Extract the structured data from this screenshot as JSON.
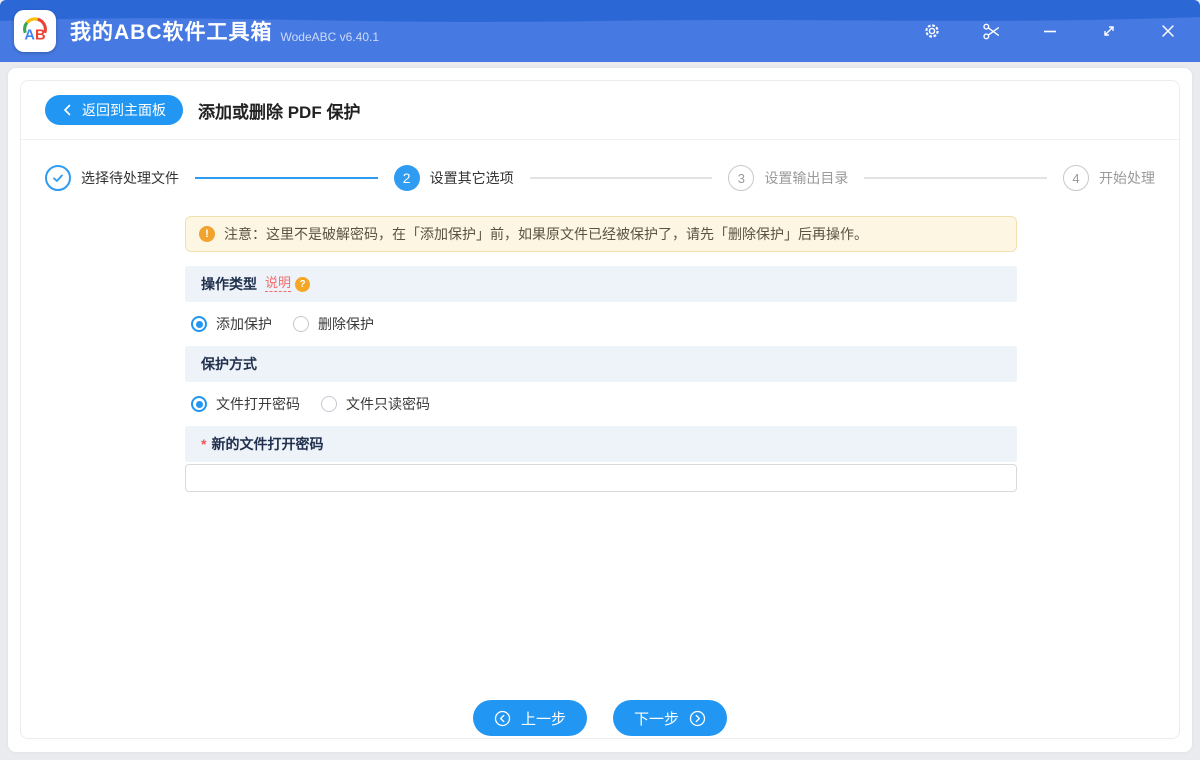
{
  "titlebar": {
    "app_name": "我的ABC软件工具箱",
    "version": "WodeABC v6.40.1",
    "controls": [
      "settings",
      "scissors",
      "minimize",
      "maximize",
      "close"
    ]
  },
  "header": {
    "back_label": "返回到主面板",
    "title": "添加或删除 PDF 保护"
  },
  "steps": [
    {
      "label": "选择待处理文件",
      "state": "done",
      "number": ""
    },
    {
      "label": "设置其它选项",
      "state": "active",
      "number": "2"
    },
    {
      "label": "设置输出目录",
      "state": "upcoming",
      "number": "3"
    },
    {
      "label": "开始处理",
      "state": "upcoming",
      "number": "4"
    }
  ],
  "notice": {
    "icon": "warning-circle",
    "text": "注意：这里不是破解密码，在「添加保护」前，如果原文件已经被保护了，请先「删除保护」后再操作。"
  },
  "sections": {
    "operation_type": {
      "title": "操作类型",
      "help_link": "说明",
      "help_icon": "?",
      "options": [
        {
          "label": "添加保护",
          "selected": true
        },
        {
          "label": "删除保护",
          "selected": false
        }
      ]
    },
    "protection_mode": {
      "title": "保护方式",
      "options": [
        {
          "label": "文件打开密码",
          "selected": true
        },
        {
          "label": "文件只读密码",
          "selected": false
        }
      ]
    },
    "password": {
      "required_mark": "*",
      "title": "新的文件打开密码",
      "value": "",
      "placeholder": ""
    }
  },
  "footer": {
    "prev_label": "上一步",
    "next_label": "下一步"
  },
  "colors": {
    "accent": "#2196f3",
    "titlebar_top": "#2c67d6",
    "titlebar_bottom": "#4679e2",
    "warning_bg": "#fdf6e2",
    "warning_border": "#f1e0ae",
    "warning_icon": "#f0a32f",
    "section_header_bg": "#eef2f9",
    "danger": "#f56c6c"
  }
}
